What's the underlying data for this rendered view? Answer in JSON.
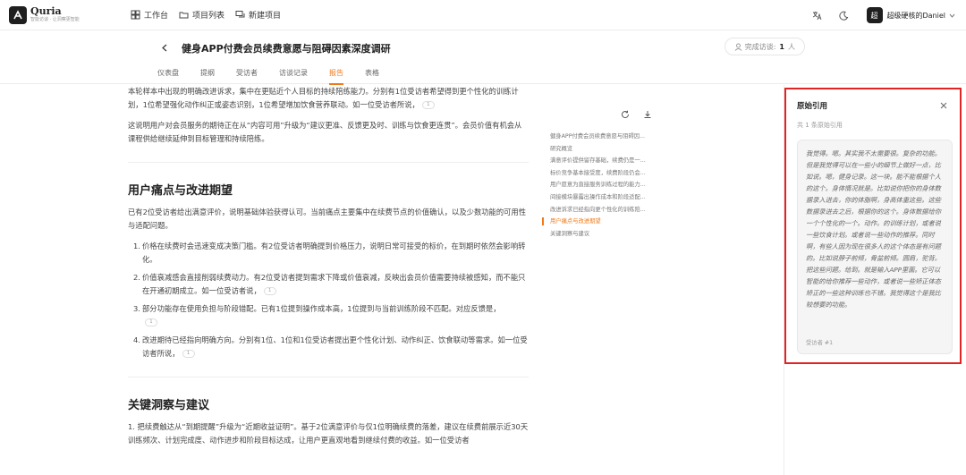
{
  "app": {
    "brand_name": "Quria",
    "brand_tagline": "智能访谈 · 让洞察更智能"
  },
  "topnav": [
    {
      "label": "工作台",
      "icon": "grid-icon"
    },
    {
      "label": "项目列表",
      "icon": "folder-icon"
    },
    {
      "label": "新建项目",
      "icon": "chat-icon"
    }
  ],
  "user": {
    "avatar": "超",
    "name": "超级硬核的Daniel"
  },
  "header": {
    "title": "健身APP付费会员续费意愿与阻碍因素深度调研",
    "visit_label": "完成访谈:",
    "visit_count": "1",
    "visit_unit": "人"
  },
  "tabs": [
    {
      "label": "仪表盘",
      "active": false
    },
    {
      "label": "提纲",
      "active": false
    },
    {
      "label": "受访者",
      "active": false
    },
    {
      "label": "访谈记录",
      "active": false
    },
    {
      "label": "报告",
      "active": true
    },
    {
      "label": "表格",
      "active": false
    }
  ],
  "report": {
    "p1": "本轮样本中出现的明确改进诉求，集中在更贴近个人目标的持续陪练能力。分别有1位受访者希望得到更个性化的训练计划，1位希望强化动作纠正或姿态识别，1位希望增加饮食营养联动。如一位受访者所说，",
    "p2": "这说明用户对会员服务的期待正在从“内容可用”升级为“建议更准、反馈更及时、训练与饮食更连贯”。会员价值有机会从课程供给继续延伸到目标管理和持续陪练。",
    "h_pain": "用户痛点与改进期望",
    "p3": "已有2位受访者给出满意评价，说明基础体验获得认可。当前痛点主要集中在续费节点的价值确认，以及少数功能的可用性与适配问题。",
    "list": [
      "价格在续费时会迅速变成决策门槛。有2位受访者明确提到价格压力，说明日常可接受的标价，在到期时依然会影响转化。",
      "价值衰减感会直接削弱续费动力。有2位受访者提到需求下降或价值衰减，反映出会员价值需要持续被感知，而不能只在开通初期成立。如一位受访者说，",
      "部分功能存在使用负担与阶段错配。已有1位提到操作成本高，1位提到与当前训练阶段不匹配。对应反馈是，",
      "改进期待已经指向明确方向。分别有1位、1位和1位受访者提出更个性化计划、动作纠正、饮食联动等需求。如一位受访者所说，"
    ],
    "h_insight": "关键洞察与建议",
    "p4": "1. 把续费触达从“到期提醒”升级为“近期收益证明”。基于2位满意评价与仅1位明确续费的落差，建议在续费前展示近30天训练频次、计划完成度、动作进步和阶段目标达成，让用户更直观地看到继续付费的收益。如一位受访者",
    "cite": "1"
  },
  "toc": [
    {
      "label": "健身APP付费会员续费意愿与阻碍因...",
      "active": false
    },
    {
      "label": "研究概览",
      "active": false
    },
    {
      "label": "满意评价提供留存基础，续费仍是一...",
      "active": false
    },
    {
      "label": "标价竞争基本接受度，续费阶段仍会...",
      "active": false
    },
    {
      "label": "用户愿意为直接服务训练过程的能力...",
      "active": false
    },
    {
      "label": "间接模块暴露出操作成本和阶段适配...",
      "active": false
    },
    {
      "label": "改进诉求已经指向更个性化的训练陪...",
      "active": false
    },
    {
      "label": "用户痛点与改进期望",
      "active": true
    },
    {
      "label": "关键洞察与建议",
      "active": false
    }
  ],
  "panel": {
    "title": "原始引用",
    "count": "共 1 条原始引用",
    "quote": "我觉得。嗯。其实我不太需要很。复杂的功能。但是我觉得可以在一些小的细节上做好一点，比如说。嗯，健身记录。这一块。能不能根据个人的这个。身体情况就是。比如说你把你的身体数据录入进去，你的体脂啊，身高体重这些。这些数据录进去之后，根据你的这个。身体数据给你一个个性化的一个。动作。的训练计划，或者说一些饮食计划。或者说一些动作的推荐。同时啊，有些人因为现在很多人的这个体态是有问题的。比如说脖子前倾，骨盆前倾。圆肩，驼背。把这些问题。给到。就是输入APP里面。它可以智能的给你推荐一些动作，或者说一些矫正体态矫正的一些这种训练也不错。我觉得这个是我比较想要的功能。",
    "source": "受访者 #1"
  }
}
